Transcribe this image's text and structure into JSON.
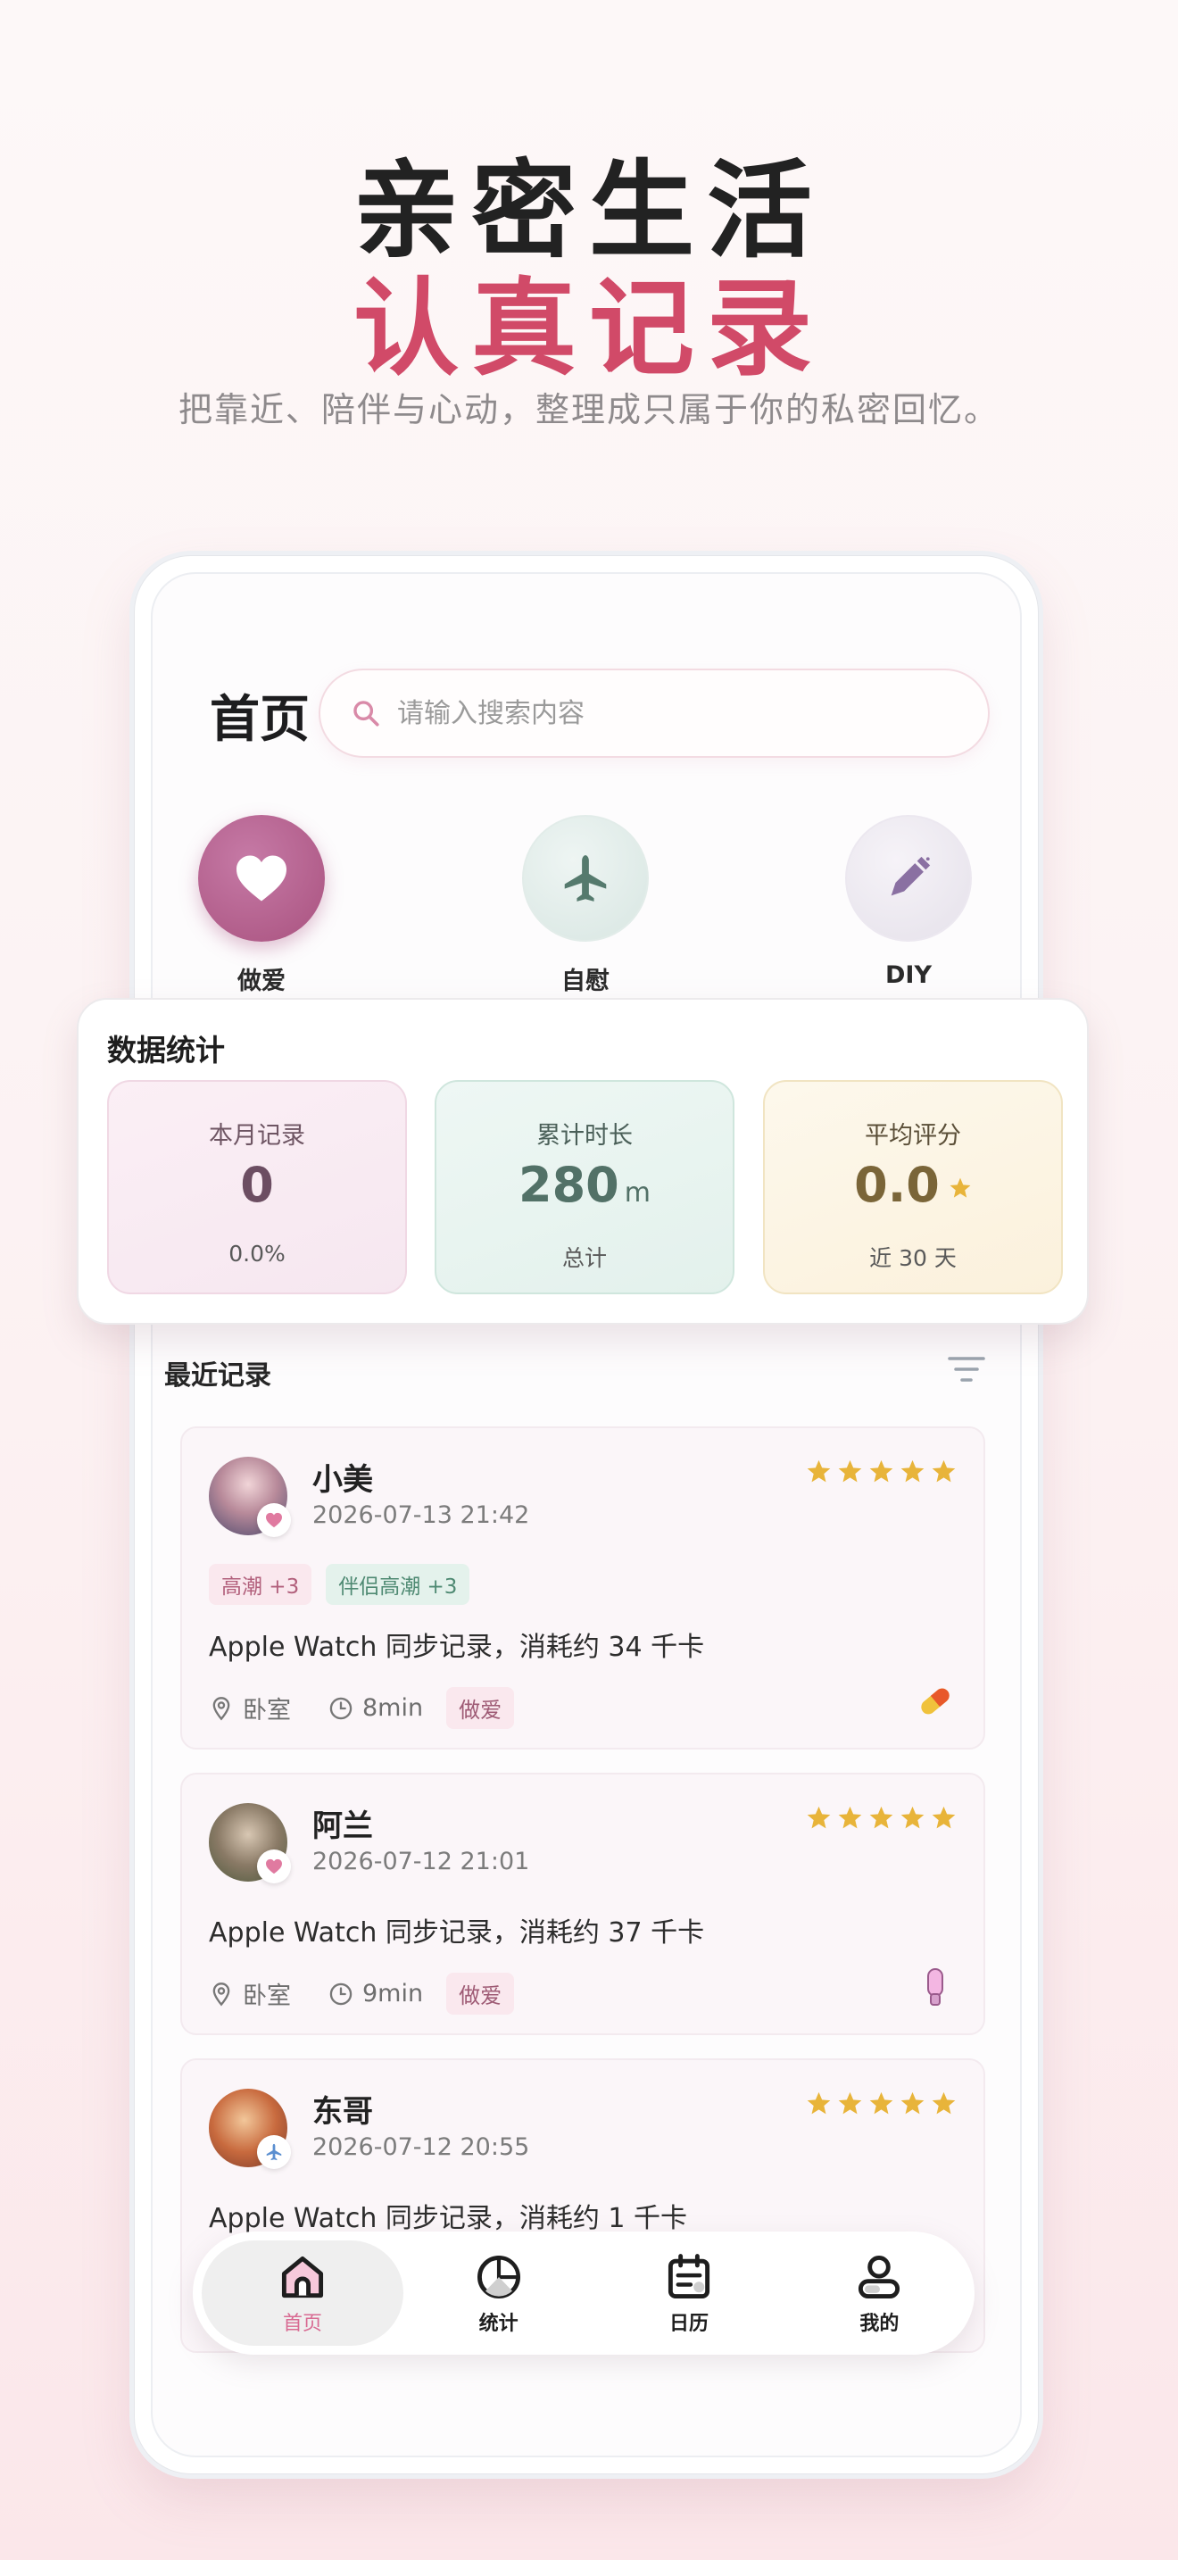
{
  "promo": {
    "title_line1": "亲密生活",
    "title_line2": "认真记录",
    "subtitle": "把靠近、陪伴与心动，整理成只属于你的私密回忆。"
  },
  "header": {
    "title": "首页",
    "search_placeholder": "请输入搜索内容"
  },
  "quick_actions": [
    {
      "label": "做爱",
      "icon": "heart-icon"
    },
    {
      "label": "自慰",
      "icon": "airplane-icon"
    },
    {
      "label": "DIY",
      "icon": "pen-icon"
    }
  ],
  "stats": {
    "title": "数据统计",
    "month": {
      "label": "本月记录",
      "value": "0",
      "sub": "0.0%"
    },
    "duration": {
      "label": "累计时长",
      "value": "280",
      "unit": "m",
      "sub": "总计"
    },
    "rating": {
      "label": "平均评分",
      "value": "0.0",
      "sub": "近 30 天"
    }
  },
  "recent": {
    "title": "最近记录",
    "records": [
      {
        "name": "小美",
        "time": "2026-07-13 21:42",
        "stars": 5,
        "tags": [
          "高潮 +3",
          "伴侣高潮 +3"
        ],
        "desc": "Apple Watch 同步记录，消耗约 34 千卡",
        "location": "卧室",
        "duration": "8min",
        "type": "做爱",
        "tool_icon": "capsule-icon"
      },
      {
        "name": "阿兰",
        "time": "2026-07-12 21:01",
        "stars": 5,
        "desc": "Apple Watch 同步记录，消耗约 37 千卡",
        "location": "卧室",
        "duration": "9min",
        "type": "做爱",
        "tool_icon": "device-icon"
      },
      {
        "name": "东哥",
        "time": "2026-07-12 20:55",
        "stars": 5,
        "desc": "Apple Watch 同步记录，消耗约 1 千卡"
      }
    ]
  },
  "nav": [
    {
      "label": "首页",
      "icon": "home-icon",
      "active": true
    },
    {
      "label": "统计",
      "icon": "pie-chart-icon"
    },
    {
      "label": "日历",
      "icon": "calendar-icon"
    },
    {
      "label": "我的",
      "icon": "profile-icon"
    }
  ],
  "colors": {
    "accent": "#d14a68",
    "nav_active": "#d86a92",
    "star": "#e8b43a"
  }
}
